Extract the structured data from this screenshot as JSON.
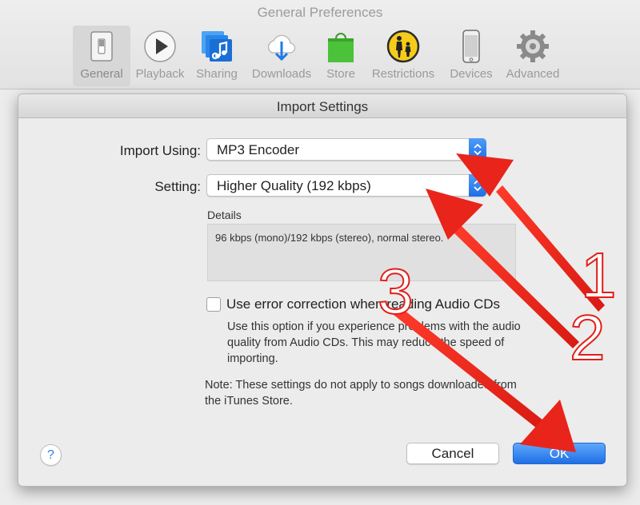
{
  "prefs": {
    "title": "General Preferences",
    "toolbar": [
      {
        "label": "General",
        "icon": "switch-icon",
        "selected": true
      },
      {
        "label": "Playback",
        "icon": "play-icon"
      },
      {
        "label": "Sharing",
        "icon": "music-sharing-icon"
      },
      {
        "label": "Downloads",
        "icon": "cloud-download-icon"
      },
      {
        "label": "Store",
        "icon": "shopping-bag-icon"
      },
      {
        "label": "Restrictions",
        "icon": "parental-restrictions-icon"
      },
      {
        "label": "Devices",
        "icon": "iphone-icon"
      },
      {
        "label": "Advanced",
        "icon": "gear-icon"
      }
    ]
  },
  "sheet": {
    "title": "Import Settings",
    "import_using_label": "Import Using:",
    "import_using_value": "MP3 Encoder",
    "setting_label": "Setting:",
    "setting_value": "Higher Quality (192 kbps)",
    "details_label": "Details",
    "details_text": "96 kbps (mono)/192 kbps (stereo), normal stereo.",
    "error_correction_label": "Use error correction when reading Audio CDs",
    "error_correction_checked": false,
    "error_correction_help": "Use this option if you experience problems with the audio quality from Audio CDs.  This may reduce the speed of importing.",
    "note": "Note: These settings do not apply to songs downloaded from the iTunes Store.",
    "help_label": "?",
    "cancel_label": "Cancel",
    "ok_label": "OK"
  },
  "annotations": {
    "numbers": [
      "1",
      "2",
      "3"
    ],
    "arrow_color": "#e02020"
  }
}
